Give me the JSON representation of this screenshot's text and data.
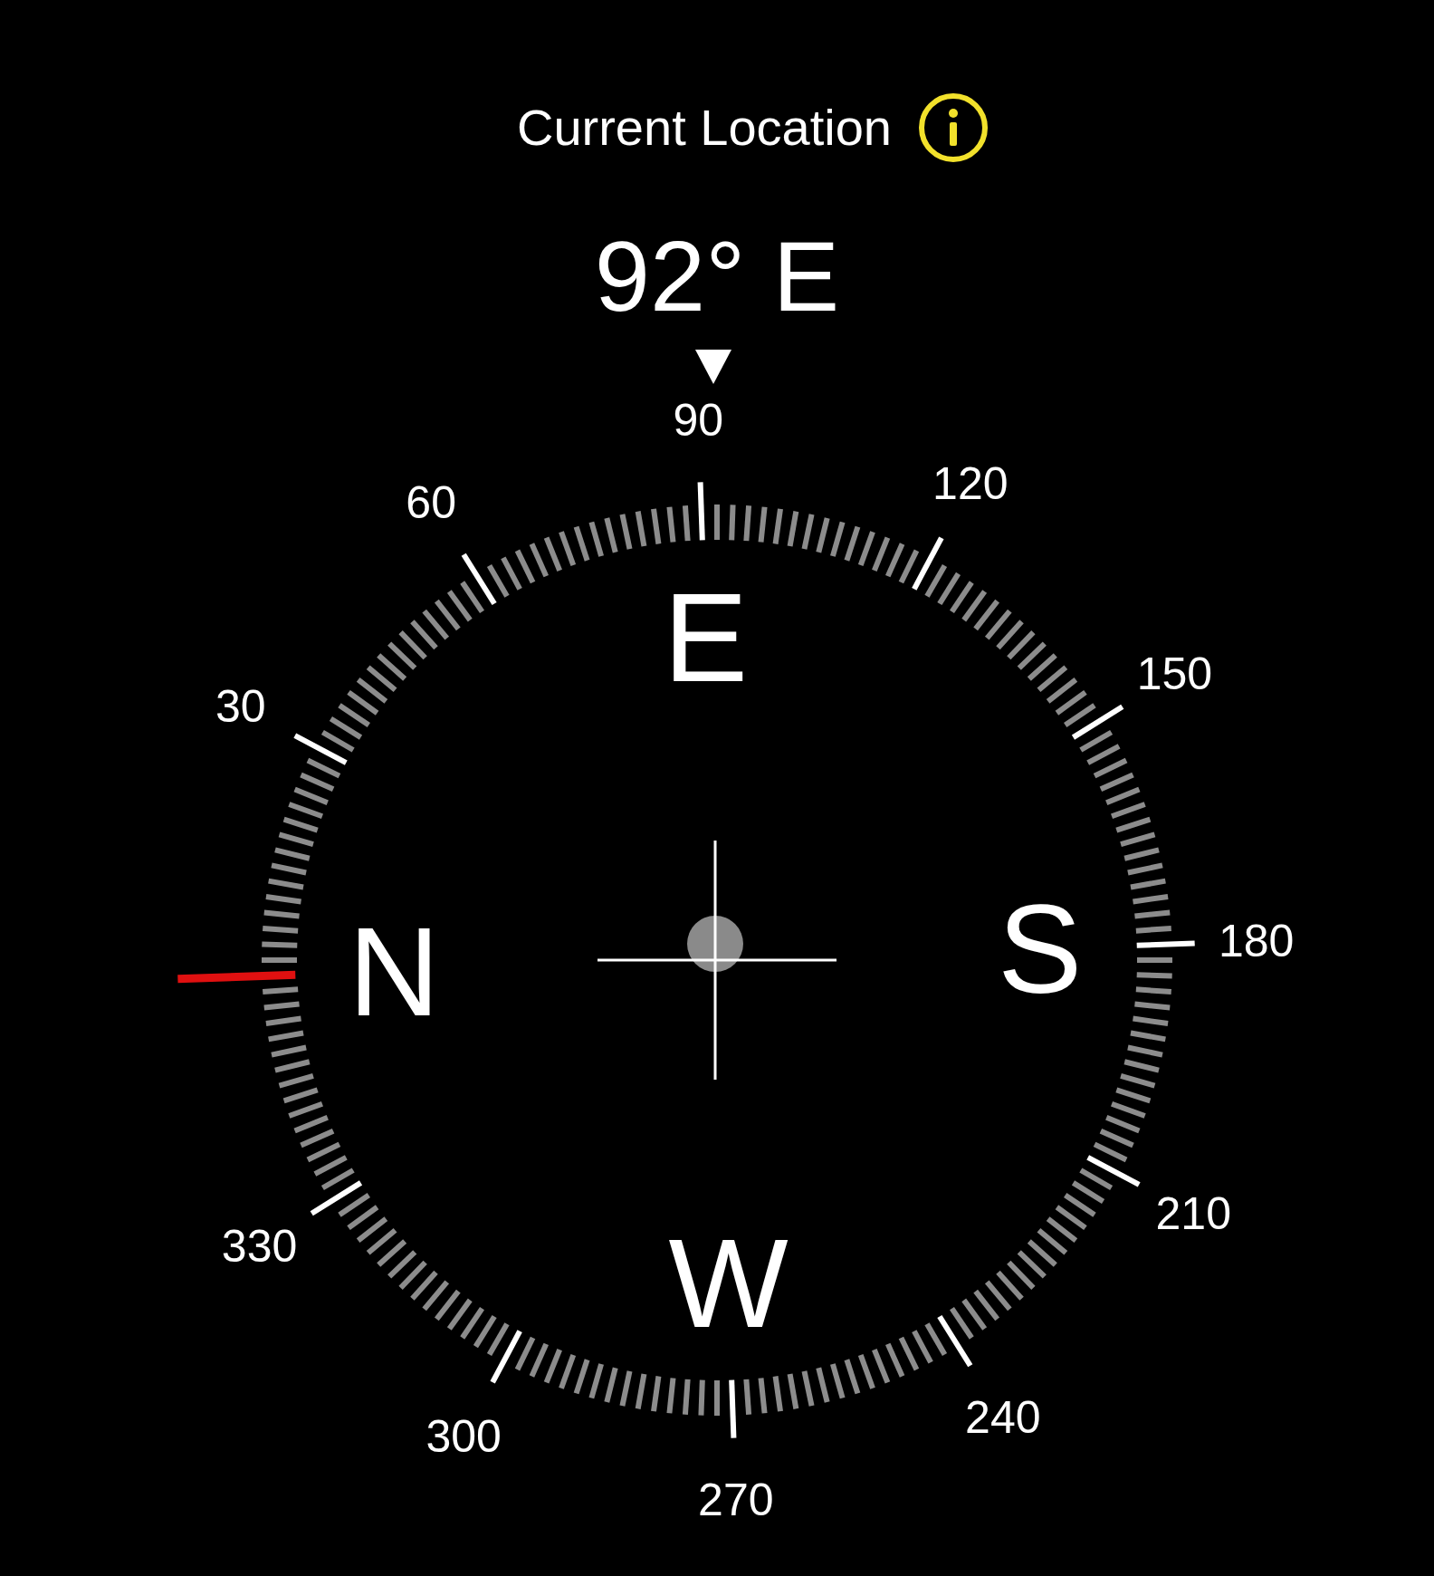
{
  "header": {
    "title": "Current Location"
  },
  "heading": "92° E",
  "dial": {
    "labels": [
      "30",
      "60",
      "90",
      "120",
      "150",
      "180",
      "210",
      "240",
      "270",
      "300",
      "330"
    ],
    "cardinals": [
      "N",
      "E",
      "S",
      "W"
    ]
  }
}
